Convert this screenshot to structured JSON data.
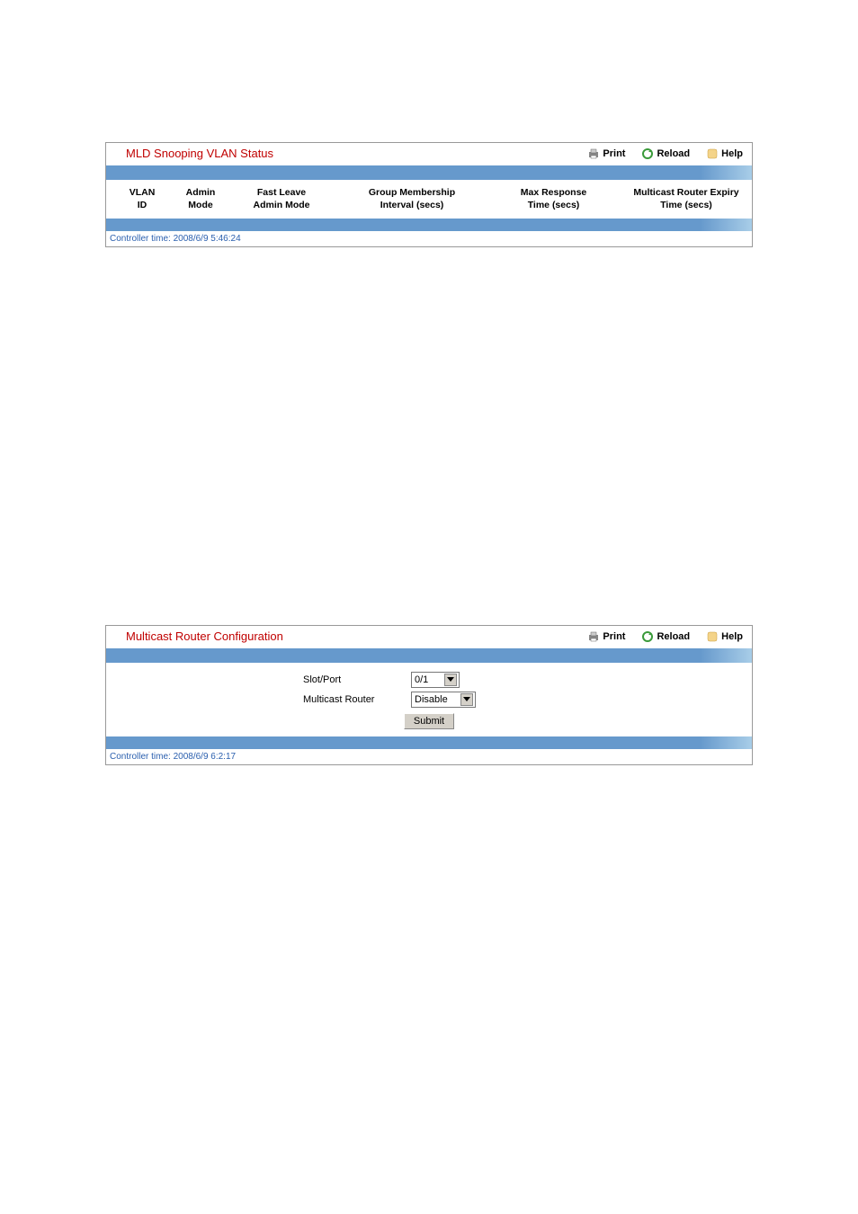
{
  "panel1": {
    "title": "MLD Snooping VLAN Status",
    "links": {
      "print": "Print",
      "reload": "Reload",
      "help": "Help"
    },
    "columns": {
      "c1a": "VLAN",
      "c1b": "ID",
      "c2a": "Admin",
      "c2b": "Mode",
      "c3a": "Fast Leave",
      "c3b": "Admin Mode",
      "c4a": "Group Membership",
      "c4b": "Interval (secs)",
      "c5a": "Max Response",
      "c5b": "Time (secs)",
      "c6a": "Multicast Router Expiry",
      "c6b": "Time (secs)"
    },
    "controller_time": "Controller time: 2008/6/9 5:46:24"
  },
  "panel2": {
    "title": "Multicast Router Configuration",
    "links": {
      "print": "Print",
      "reload": "Reload",
      "help": "Help"
    },
    "form": {
      "slot_port_label": "Slot/Port",
      "slot_port_value": "0/1",
      "mrouter_label": "Multicast Router",
      "mrouter_value": "Disable",
      "submit": "Submit"
    },
    "controller_time": "Controller time: 2008/6/9 6:2:17"
  }
}
